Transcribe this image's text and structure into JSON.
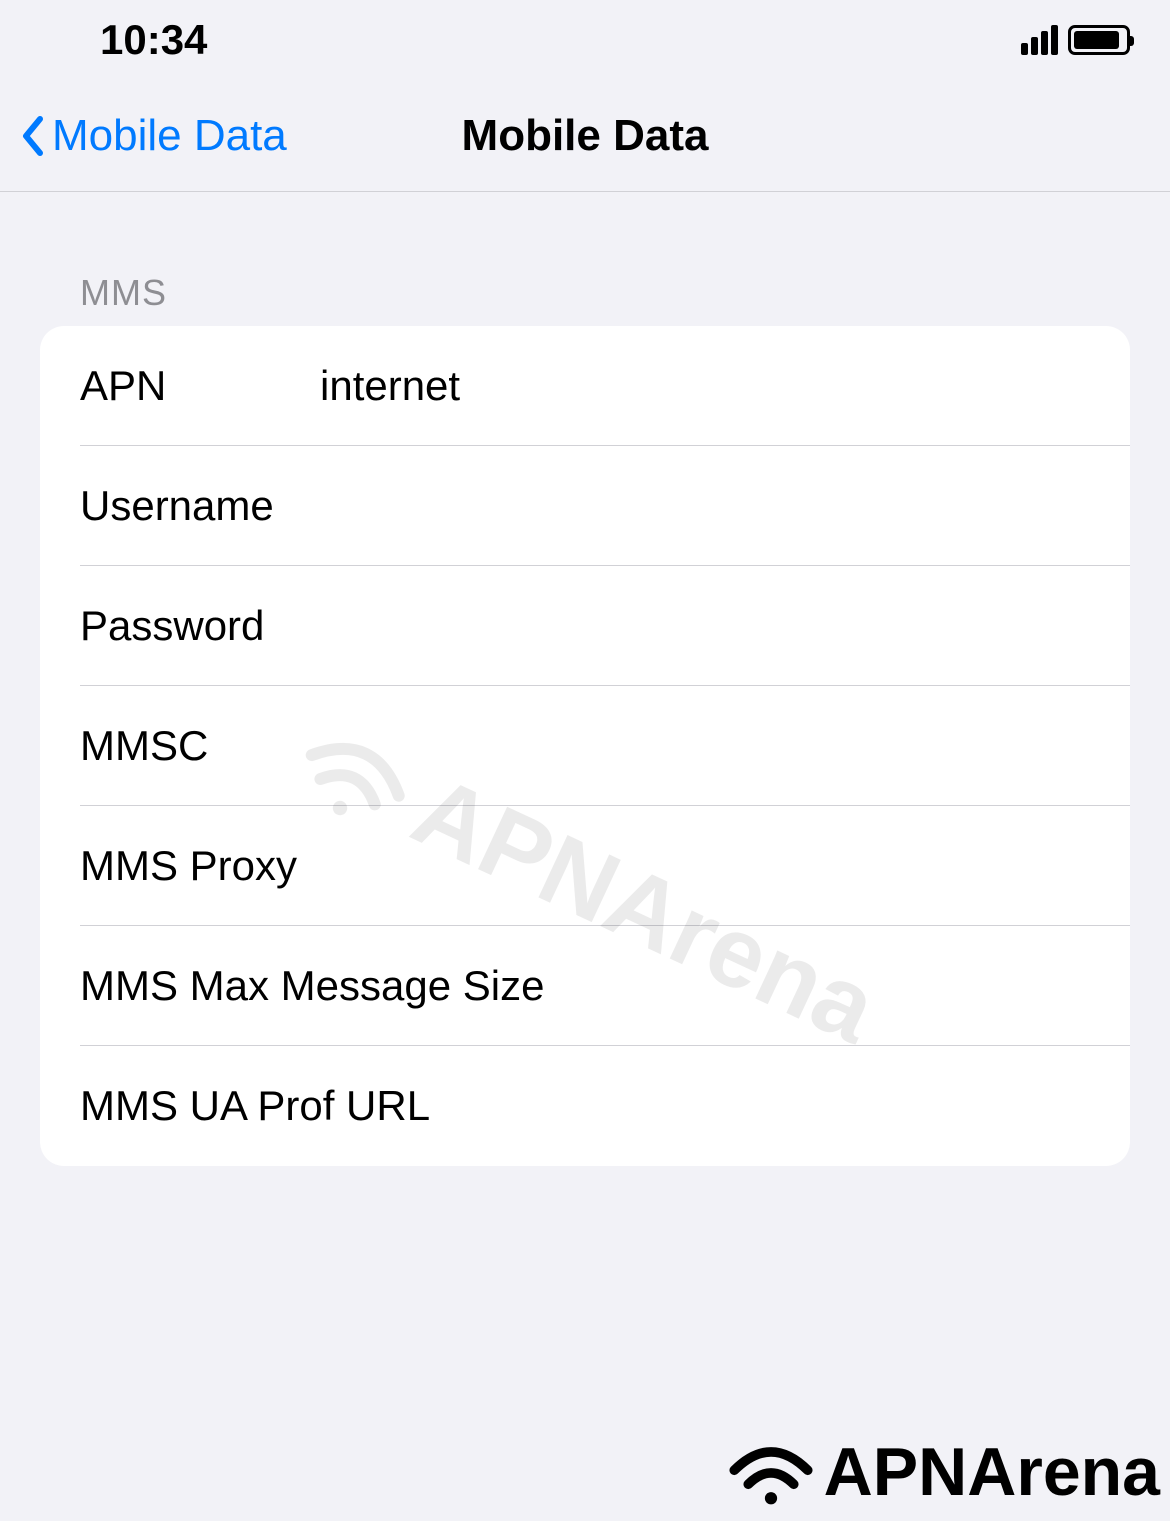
{
  "status_bar": {
    "time": "10:34"
  },
  "navigation": {
    "back_label": "Mobile Data",
    "title": "Mobile Data"
  },
  "section": {
    "header": "MMS",
    "rows": [
      {
        "label": "APN",
        "value": "internet"
      },
      {
        "label": "Username",
        "value": ""
      },
      {
        "label": "Password",
        "value": ""
      },
      {
        "label": "MMSC",
        "value": ""
      },
      {
        "label": "MMS Proxy",
        "value": ""
      },
      {
        "label": "MMS Max Message Size",
        "value": ""
      },
      {
        "label": "MMS UA Prof URL",
        "value": ""
      }
    ]
  },
  "watermark": {
    "text": "APNArena"
  }
}
